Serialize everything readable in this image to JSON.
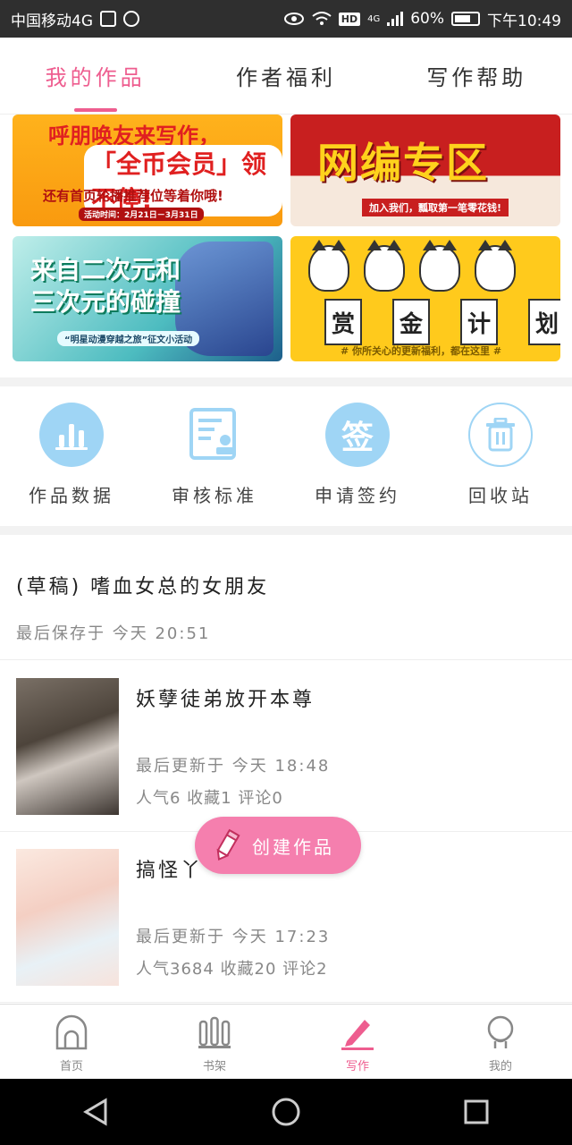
{
  "status_bar": {
    "carrier": "中国移动4G",
    "hd_badge": "HD",
    "network": "4G",
    "battery": "60%",
    "time": "下午10:49"
  },
  "tabs": [
    {
      "label": "我的作品",
      "active": true
    },
    {
      "label": "作者福利",
      "active": false
    },
    {
      "label": "写作帮助",
      "active": false
    }
  ],
  "banners": {
    "b1": {
      "line1": "呼朋唤友来写作，",
      "line2": "「全币会员」领不停!",
      "line3": "还有首页轮播推荐位等着你哦!",
      "line4": "活动时间：2月21日－3月31日"
    },
    "b2": {
      "title": "网编专区",
      "sub": "加入我们，瓢取第一笔零花钱!"
    },
    "b3": {
      "title1": "来自二次元和",
      "title2": "三次元的碰撞",
      "sub": "“明星动漫穿越之旅”征文小活动"
    },
    "b4": {
      "chars": [
        "赏",
        "金",
        "计",
        "划"
      ],
      "sub": "# 你所关心的更新福利，都在这里 #"
    }
  },
  "features": [
    {
      "label": "作品数据",
      "icon": "bar-chart-icon"
    },
    {
      "label": "审核标准",
      "icon": "document-stamp-icon"
    },
    {
      "label": "申请签约",
      "icon": "sign-icon",
      "icon_text": "签"
    },
    {
      "label": "回收站",
      "icon": "trash-icon"
    }
  ],
  "draft": {
    "title": "(草稿) 嗜血女总的女朋友",
    "saved_prefix": "最后保存于",
    "saved_day": "今天",
    "saved_time": "20:51"
  },
  "works": [
    {
      "name": "妖孽徒弟放开本尊",
      "updated_prefix": "最后更新于",
      "updated_day": "今天",
      "updated_time": "18:48",
      "stats": "人气6 收藏1 评论0"
    },
    {
      "name": "搞怪丫",
      "updated_prefix": "最后更新于",
      "updated_day": "今天",
      "updated_time": "17:23",
      "stats": "人气3684 收藏20 评论2"
    }
  ],
  "fab": {
    "label": "创建作品"
  },
  "bottom_nav": [
    {
      "label": "首页",
      "icon": "home-icon",
      "active": false
    },
    {
      "label": "书架",
      "icon": "bookshelf-icon",
      "active": false
    },
    {
      "label": "写作",
      "icon": "pen-icon",
      "active": true
    },
    {
      "label": "我的",
      "icon": "profile-icon",
      "active": false
    }
  ],
  "colors": {
    "accent": "#ee5d8f",
    "fab": "#f57fae",
    "feature_icon": "#9fd5f5"
  }
}
